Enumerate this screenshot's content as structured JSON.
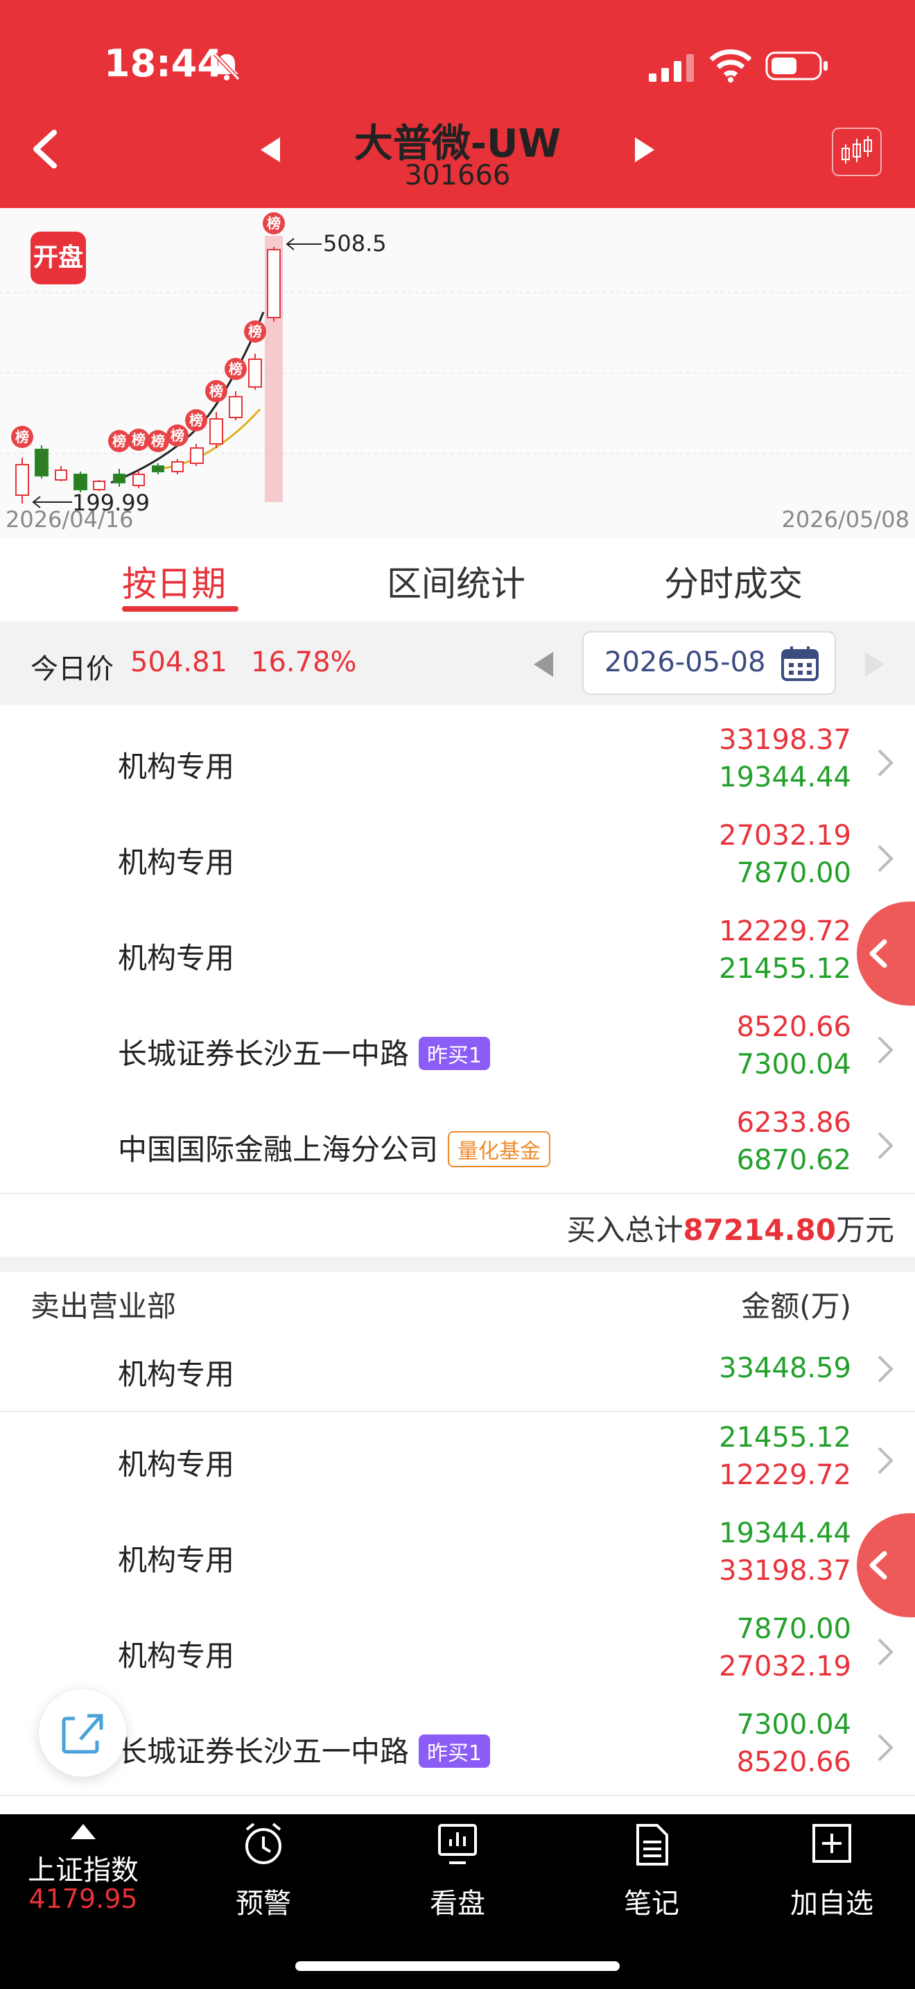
{
  "status_bar": {
    "time": "18:44"
  },
  "header": {
    "stock_name": "大普微-UW",
    "stock_code": "301666"
  },
  "chart": {
    "badge": "开盘",
    "marker_label": "榜",
    "high_label": "508.5",
    "low_label": "199.99",
    "start_date": "2026/04/16",
    "end_date": "2026/05/08"
  },
  "tabs": [
    "按日期",
    "区间统计",
    "分时成交"
  ],
  "price_bar": {
    "label": "今日价",
    "price": "504.81",
    "change": "16.78%",
    "date": "2026-05-08"
  },
  "buy_rows": [
    {
      "name": "机构专用",
      "tag": "",
      "v1": "33198.37",
      "v2": "19344.44"
    },
    {
      "name": "机构专用",
      "tag": "",
      "v1": "27032.19",
      "v2": "7870.00"
    },
    {
      "name": "机构专用",
      "tag": "",
      "v1": "12229.72",
      "v2": "21455.12"
    },
    {
      "name": "长城证券长沙五一中路",
      "tag": "昨买1",
      "v1": "8520.66",
      "v2": "7300.04"
    },
    {
      "name": "中国国际金融上海分公司",
      "tag": "量化基金",
      "v1": "6233.86",
      "v2": "6870.62"
    }
  ],
  "buy_total": {
    "label": "买入总计",
    "value": "87214.80",
    "unit": "万元"
  },
  "sell_section": {
    "title": "卖出营业部",
    "amount_header": "金额(万)"
  },
  "sell_rows": [
    {
      "name": "机构专用",
      "tag": "",
      "v1": "33448.59"
    },
    {
      "name": "机构专用",
      "tag": "",
      "v1": "21455.12",
      "v2": "12229.72"
    },
    {
      "name": "机构专用",
      "tag": "",
      "v1": "19344.44",
      "v2": "33198.37"
    },
    {
      "name": "机构专用",
      "tag": "",
      "v1": "7870.00",
      "v2": "27032.19"
    },
    {
      "name": "长城证券长沙五一中路",
      "tag": "昨买1",
      "v1": "7300.04",
      "v2": "8520.66"
    }
  ],
  "bottom_nav": {
    "index_label": "上证指数",
    "index_value": "4179.95",
    "items": [
      "预警",
      "看盘",
      "笔记",
      "加自选"
    ]
  },
  "colors": {
    "brand_red": "#e8323a",
    "green": "#22a02a",
    "tag_purple": "#8b5cf6",
    "tag_orange": "#ef8a2b"
  }
}
